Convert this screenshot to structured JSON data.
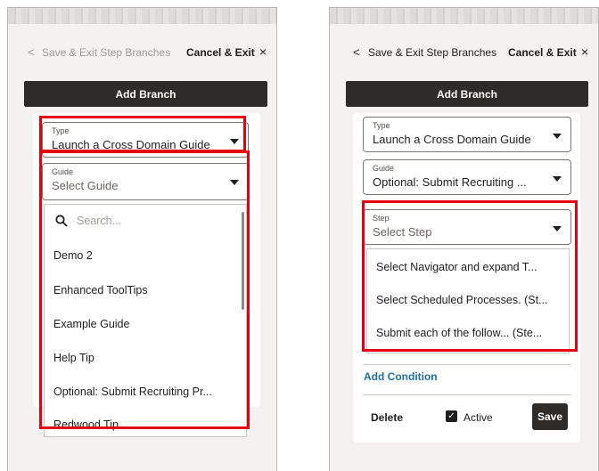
{
  "left": {
    "topbar": {
      "back": "<",
      "save_exit": "Save & Exit Step Branches",
      "cancel": "Cancel & Exit",
      "close": "×"
    },
    "add_branch": "Add Branch",
    "type_field": {
      "label": "Type",
      "value": "Launch a Cross Domain Guide"
    },
    "guide_field": {
      "label": "Guide",
      "placeholder": "Select Guide"
    },
    "search_placeholder": "Search...",
    "guides": [
      "Demo 2",
      "Enhanced ToolTips",
      "Example Guide",
      "Help Tip",
      "Optional: Submit Recruiting Pr...",
      "Redwood Tip"
    ]
  },
  "right": {
    "topbar": {
      "back": "<",
      "save_exit": "Save & Exit Step Branches",
      "cancel": "Cancel & Exit",
      "close": "×"
    },
    "add_branch": "Add Branch",
    "type_field": {
      "label": "Type",
      "value": "Launch a Cross Domain Guide"
    },
    "guide_field": {
      "label": "Guide",
      "value": "Optional: Submit Recruiting ..."
    },
    "step_field": {
      "label": "Step",
      "placeholder": "Select Step"
    },
    "steps": [
      "Select Navigator and expand T...",
      "Select Scheduled Processes. (St...",
      "Submit each of the follow... (Ste..."
    ],
    "add_condition": "Add Condition",
    "delete": "Delete",
    "active": "Active",
    "save": "Save"
  }
}
